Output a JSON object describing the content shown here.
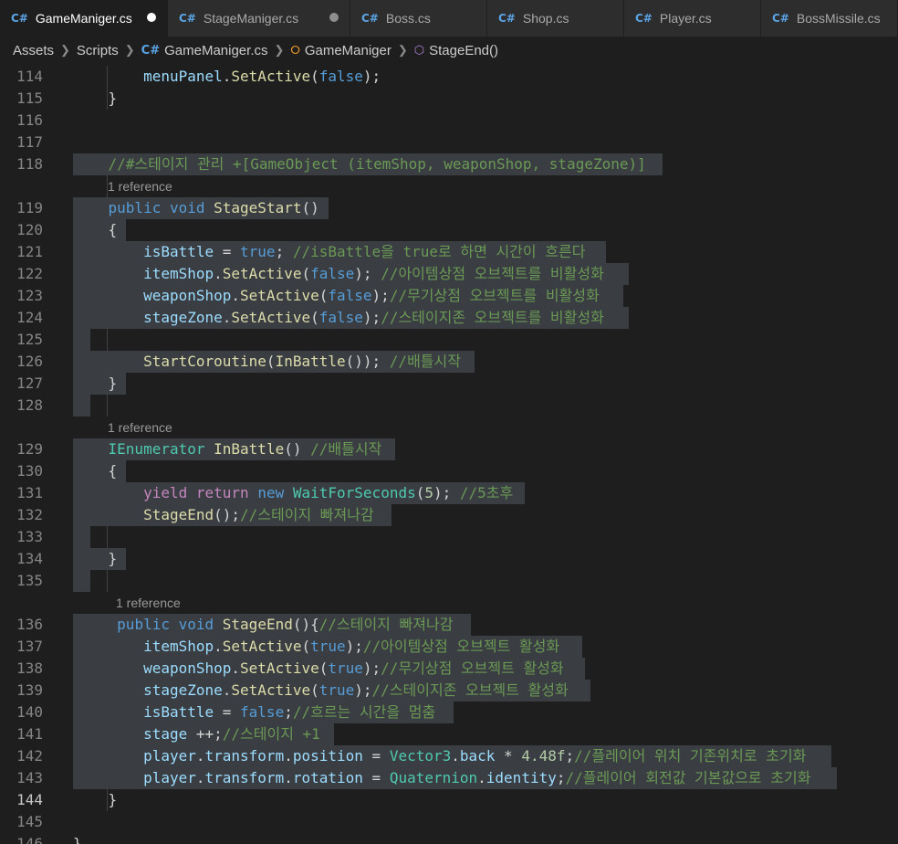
{
  "tabs": [
    {
      "label": "GameManiger.cs",
      "active": true,
      "modified": true
    },
    {
      "label": "StageManiger.cs",
      "active": false,
      "modified": true
    },
    {
      "label": "Boss.cs",
      "active": false,
      "modified": false
    },
    {
      "label": "Shop.cs",
      "active": false,
      "modified": false
    },
    {
      "label": "Player.cs",
      "active": false,
      "modified": false
    },
    {
      "label": "BossMissile.cs",
      "active": false,
      "modified": false
    }
  ],
  "breadcrumb": [
    "Assets",
    "Scripts",
    "GameManiger.cs",
    "GameManiger",
    "StageEnd()"
  ],
  "lines": [
    {
      "n": "114",
      "text": "        menuPanel.SetActive(false);"
    },
    {
      "n": "115",
      "text": "    }"
    },
    {
      "n": "116",
      "text": ""
    },
    {
      "n": "117",
      "text": ""
    },
    {
      "n": "118",
      "text": "    //#스테이지 관리 +[GameObject (itemShop, weaponShop, stageZone)]"
    },
    {
      "n": "119",
      "text": "    public void StageStart()"
    },
    {
      "n": "120",
      "text": "    {"
    },
    {
      "n": "121",
      "text": "        isBattle = true; //isBattle을 true로 하면 시간이 흐른다"
    },
    {
      "n": "122",
      "text": "        itemShop.SetActive(false); //아이템상점 오브젝트를 비활성화"
    },
    {
      "n": "123",
      "text": "        weaponShop.SetActive(false);//무기상점 오브젝트를 비활성화"
    },
    {
      "n": "124",
      "text": "        stageZone.SetActive(false);//스테이지존 오브젝트를 비활성화"
    },
    {
      "n": "125",
      "text": ""
    },
    {
      "n": "126",
      "text": "        StartCoroutine(InBattle()); //배틀시작"
    },
    {
      "n": "127",
      "text": "    }"
    },
    {
      "n": "128",
      "text": ""
    },
    {
      "n": "129",
      "text": "    IEnumerator InBattle() //배틀시작"
    },
    {
      "n": "130",
      "text": "    {"
    },
    {
      "n": "131",
      "text": "        yield return new WaitForSeconds(5); //5초후"
    },
    {
      "n": "132",
      "text": "        StageEnd();//스테이지 빠져나감"
    },
    {
      "n": "133",
      "text": ""
    },
    {
      "n": "134",
      "text": "    }"
    },
    {
      "n": "135",
      "text": ""
    },
    {
      "n": "136",
      "text": "     public void StageEnd(){//스테이지 빠져나감"
    },
    {
      "n": "137",
      "text": "        itemShop.SetActive(true);//아이템상점 오브젝트 활성화"
    },
    {
      "n": "138",
      "text": "        weaponShop.SetActive(true);//무기상점 오브젝트 활성화"
    },
    {
      "n": "139",
      "text": "        stageZone.SetActive(true);//스테이지존 오브젝트 활성화"
    },
    {
      "n": "140",
      "text": "        isBattle = false;//흐르는 시간을 멈춤"
    },
    {
      "n": "141",
      "text": "        stage ++;//스테이지 +1"
    },
    {
      "n": "142",
      "text": "        player.transform.position = Vector3.back * 4.48f;//플레이어 위치 기존위치로 초기화"
    },
    {
      "n": "143",
      "text": "        player.transform.rotation = Quaternion.identity;//플레이어 회전값 기본값으로 초기화"
    },
    {
      "n": "144",
      "text": "    }"
    },
    {
      "n": "145",
      "text": ""
    },
    {
      "n": "146",
      "text": "}"
    }
  ],
  "current_line": "144",
  "codelens": [
    "1 reference",
    "1 reference",
    "1 reference"
  ],
  "colors": {
    "keyword": "#569cd6",
    "function": "#dcdcaa",
    "type": "#4ec9b0",
    "comment": "#6a9955",
    "variable": "#9cdcfe",
    "number": "#b5cea8",
    "control": "#c586c0",
    "selection": "#3a3d41",
    "editor_bg": "#1e1e1e"
  }
}
